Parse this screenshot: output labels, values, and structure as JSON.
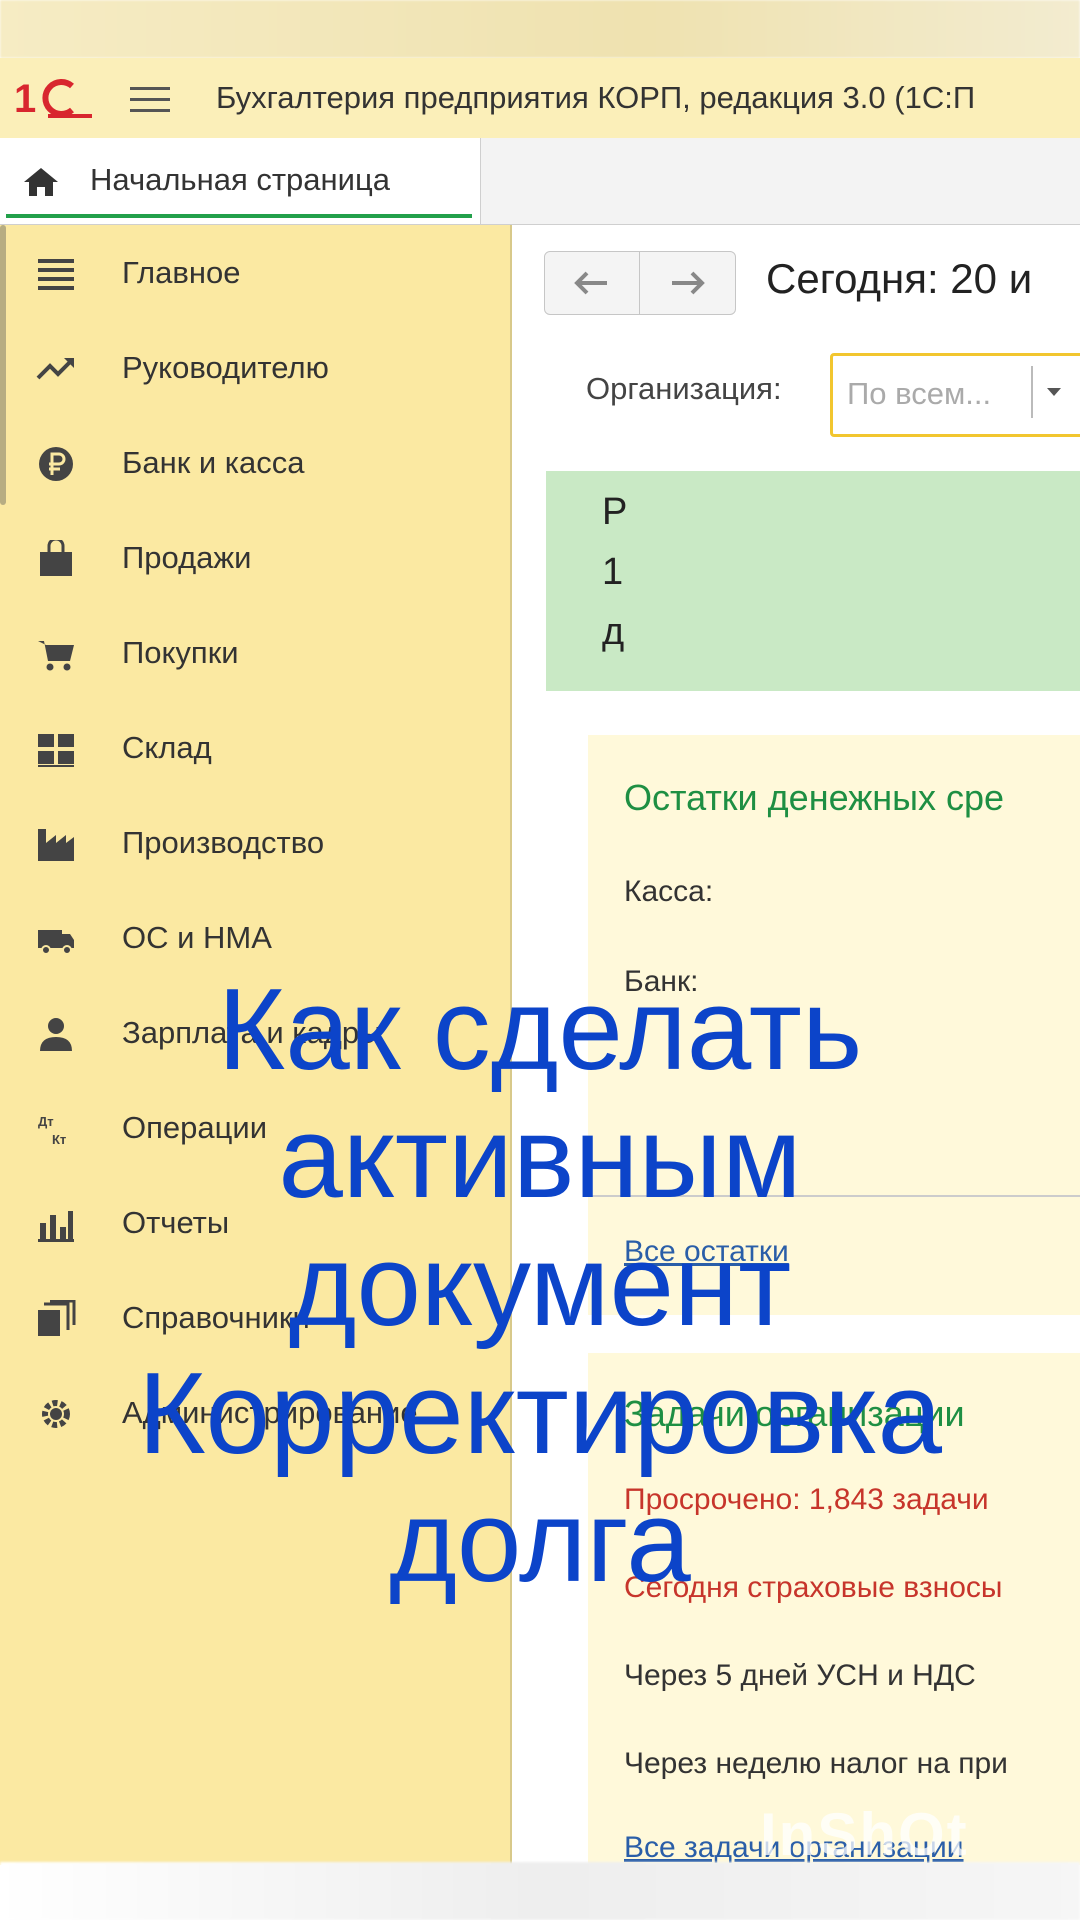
{
  "app": {
    "title": "Бухгалтерия предприятия КОРП, редакция 3.0  (1С:П",
    "logo_text": "1С"
  },
  "tabs": {
    "home_label": "Начальная страница"
  },
  "sidebar": {
    "items": [
      {
        "label": "Главное",
        "icon": "menu-list-icon"
      },
      {
        "label": "Руководителю",
        "icon": "trend-chart-icon"
      },
      {
        "label": "Банк и касса",
        "icon": "ruble-coin-icon"
      },
      {
        "label": "Продажи",
        "icon": "shopping-bag-icon"
      },
      {
        "label": "Покупки",
        "icon": "cart-icon"
      },
      {
        "label": "Склад",
        "icon": "warehouse-grid-icon"
      },
      {
        "label": "Производство",
        "icon": "factory-icon"
      },
      {
        "label": "ОС и НМА",
        "icon": "truck-icon"
      },
      {
        "label": "Зарплата и кадры",
        "icon": "person-icon"
      },
      {
        "label": "Операции",
        "icon": "debit-credit-icon"
      },
      {
        "label": "Отчеты",
        "icon": "bar-chart-icon"
      },
      {
        "label": "Справочники",
        "icon": "books-icon"
      },
      {
        "label": "Администрирование",
        "icon": "gear-icon"
      }
    ]
  },
  "main": {
    "today": "Сегодня: 20 и",
    "org_label": "Организация:",
    "org_placeholder": "По всем...",
    "green_panel_lines": [
      "Р",
      "1",
      "д"
    ],
    "balances": {
      "title": "Остатки денежных сре",
      "cash_label": "Касса:",
      "bank_label": "Банк:",
      "link": "Все остатки"
    },
    "tasks": {
      "title": "Задачи организации",
      "overdue": "Просрочено: 1,843 задачи",
      "today": "Сегодня страховые взносы",
      "in5days": "Через 5 дней УСН и НДС",
      "in_week": "Через неделю налог на при",
      "link": "Все задачи организации"
    }
  },
  "overlay": {
    "lines": [
      "Как  сделать",
      "активным",
      "документ",
      "Корректировка",
      "долга"
    ],
    "color": "#0c44c9"
  },
  "watermark": "InShOt"
}
